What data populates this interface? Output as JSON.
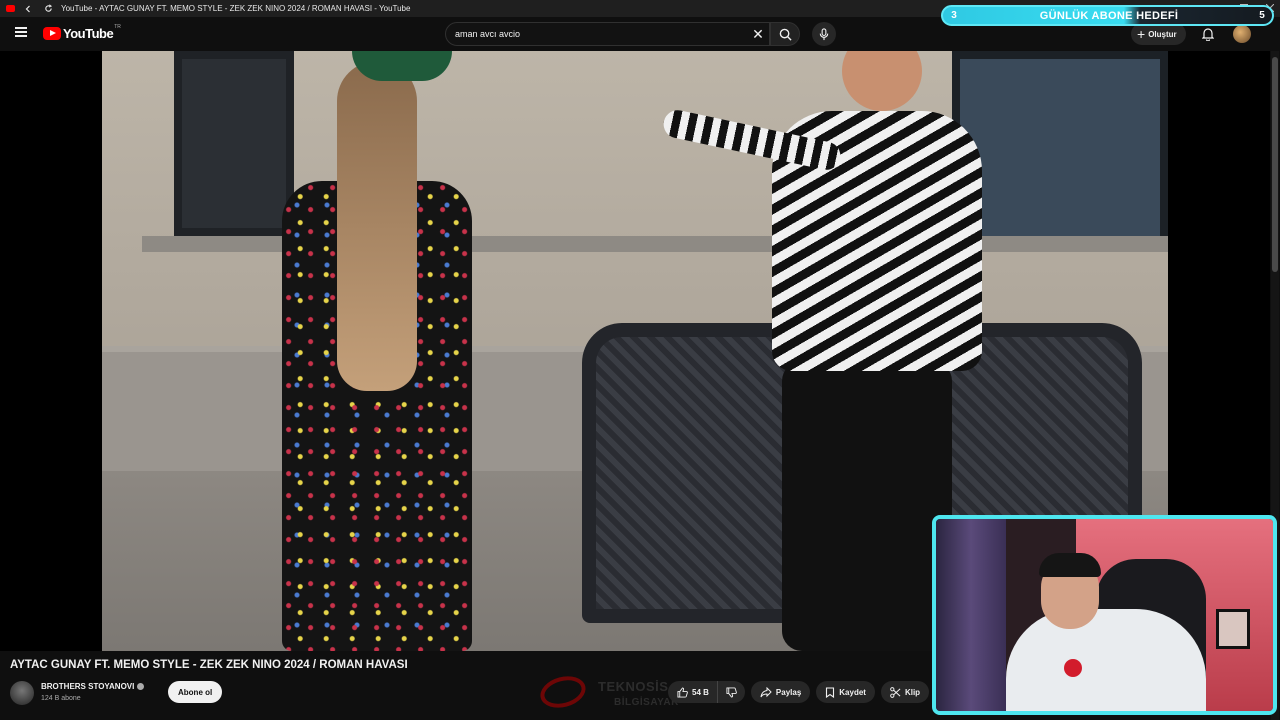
{
  "window": {
    "title": "YouTube - AYTAC GUNAY FT. MEMO STYLE - ZEK ZEK NINO 2024 / ROMAN HAVASI - YouTube"
  },
  "goal_overlay": {
    "current": "3",
    "label": "GÜNLÜK ABONE HEDEFİ",
    "target": "5",
    "progress": 0.6
  },
  "header": {
    "logo_text": "YouTube",
    "region": "TR",
    "search_value": "aman avcı avcio",
    "create_label": "Oluştur"
  },
  "video": {
    "title": "AYTAC GUNAY FT. MEMO STYLE - ZEK ZEK NINO 2024 / ROMAN HAVASI",
    "channel_name": "BROTHERS STOYANOVI",
    "subscribers": "124 B abone",
    "subscribe_label": "Abone ol"
  },
  "watermark": {
    "line1": "TEKNOSİS",
    "line2": "BİLGİSAYAR"
  },
  "actions": {
    "likes": "54 B",
    "share": "Paylaş",
    "save": "Kaydet",
    "clip": "Klip"
  },
  "colors": {
    "youtube_red": "#ff0000",
    "overlay_cyan": "#4ee6ef"
  }
}
